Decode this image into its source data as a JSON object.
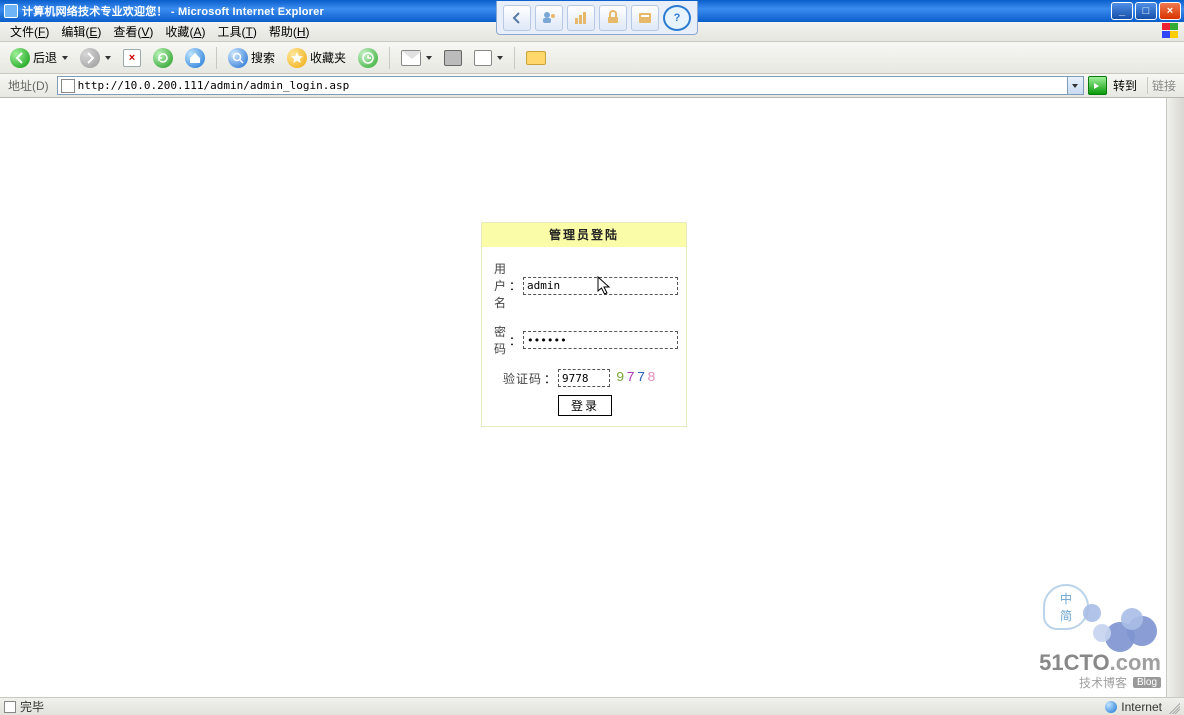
{
  "titlebar": {
    "title": "计算机网络技术专业欢迎您！ - Microsoft Internet Explorer"
  },
  "menubar": {
    "file": {
      "label": "文件",
      "accel": "F"
    },
    "edit": {
      "label": "编辑",
      "accel": "E"
    },
    "view": {
      "label": "查看",
      "accel": "V"
    },
    "fav": {
      "label": "收藏",
      "accel": "A"
    },
    "tools": {
      "label": "工具",
      "accel": "T"
    },
    "help": {
      "label": "帮助",
      "accel": "H"
    }
  },
  "toolbar": {
    "back": "后退",
    "search": "搜索",
    "fav": "收藏夹"
  },
  "addressbar": {
    "label": "地址(D)",
    "url": "http://10.0.200.111/admin/admin_login.asp",
    "go": "转到",
    "links": "链接"
  },
  "login": {
    "title": "管理员登陆",
    "username_label": "用户名",
    "username_value": "admin",
    "password_label": "密  码",
    "password_value": "••••••",
    "captcha_label": "验证码",
    "captcha_value": "9778",
    "captcha_image_digits": {
      "d1": "9",
      "d2": "7",
      "d3": "7",
      "d4": "8"
    },
    "submit_label": "登录"
  },
  "watermark": {
    "stamp_top": "中",
    "stamp_bottom": "简",
    "logo_main": "51CTO",
    "logo_suffix": ".com",
    "subline": "技术博客",
    "blog_badge": "Blog"
  },
  "statusbar": {
    "left": "完毕",
    "zone": "Internet"
  }
}
